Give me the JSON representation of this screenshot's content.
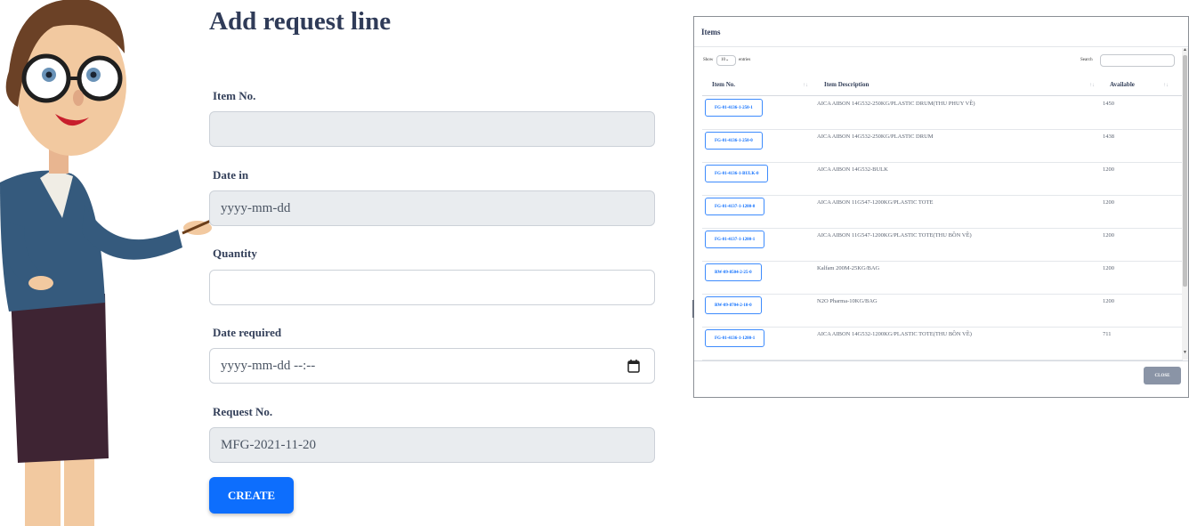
{
  "form": {
    "title": "Add request line",
    "item_no": {
      "label": "Item No.",
      "value": ""
    },
    "date_in": {
      "label": "Date in",
      "placeholder": "yyyy-mm-dd"
    },
    "quantity": {
      "label": "Quantity",
      "value": ""
    },
    "date_required": {
      "label": "Date required",
      "placeholder": "yyyy-mm-dd --:--"
    },
    "request_no": {
      "label": "Request No.",
      "value": "MFG-2021-11-20"
    },
    "create_label": "CREATE"
  },
  "modal": {
    "title": "Items",
    "show_label": "Show",
    "entries_value": "10",
    "entries_label": "entries",
    "search_label": "Search",
    "columns": [
      "Item No.",
      "Item Description",
      "Available"
    ],
    "rows": [
      {
        "item_no": "FG-01-4136-1-250-1",
        "description": "AICA AIBON 14G532-250KG/PLASTIC DRUM(THU PHUY VỀ)",
        "available": "1450"
      },
      {
        "item_no": "FG-01-4136-1-250-0",
        "description": "AICA AIBON 14G532-250KG/PLASTIC DRUM",
        "available": "1438"
      },
      {
        "item_no": "FG-01-4136-1-BULK-0",
        "description": "AICA AIBON 14G532-BULK",
        "available": "1200"
      },
      {
        "item_no": "FG-01-4137-1-1200-0",
        "description": "AICA AIBON 11G547-1200KG/PLASTIC TOTE",
        "available": "1200"
      },
      {
        "item_no": "FG-01-4137-1-1200-1",
        "description": "AICA AIBON 11G547-1200KG/PLASTIC TOTE(THU BỒN VỀ)",
        "available": "1200"
      },
      {
        "item_no": "RW-09-8504-2-25-0",
        "description": "Kalfam 200M-25KG/BAG",
        "available": "1200"
      },
      {
        "item_no": "RW-09-8704-2-10-0",
        "description": "N2O Pharma-10KG/BAG",
        "available": "1200"
      },
      {
        "item_no": "FG-01-4136-1-1200-1",
        "description": "AICA AIBON 14G532-1200KG/PLASTIC TOTE(THU BỒN VỀ)",
        "available": "711"
      }
    ],
    "close_label": "CLOSE"
  },
  "colors": {
    "primary": "#0d6efd",
    "close_button": "#8a94a6",
    "title": "#2f3b58"
  },
  "icons": [
    "calendar-icon",
    "sort-icon",
    "dropdown-icon"
  ]
}
